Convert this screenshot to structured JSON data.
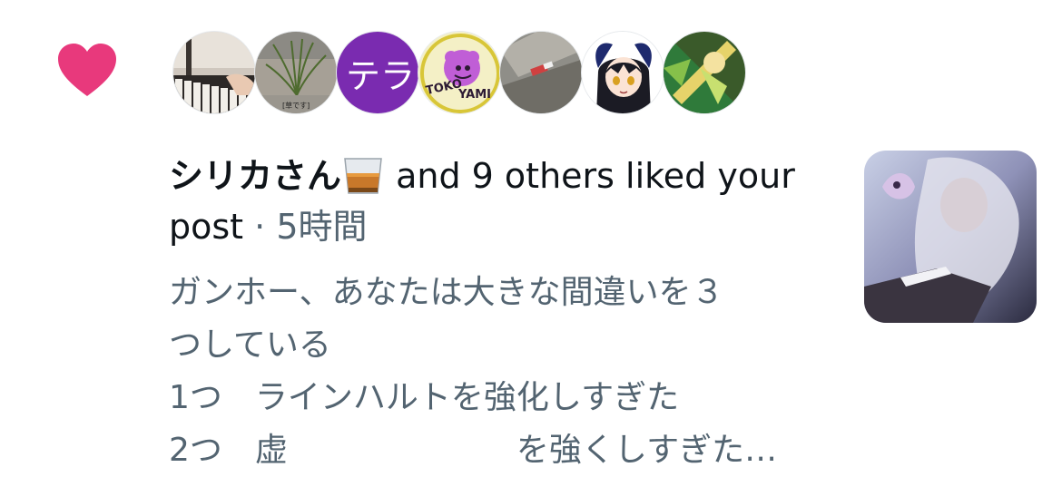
{
  "notification": {
    "type_icon": "heart-icon",
    "accent_color": "#e8397c",
    "avatars": [
      {
        "name": "avatar-piano",
        "kind": "photo"
      },
      {
        "name": "avatar-grass",
        "kind": "photo",
        "caption": "[草です]"
      },
      {
        "name": "avatar-tera",
        "kind": "initials",
        "initials": "テラ"
      },
      {
        "name": "avatar-tokoyami",
        "kind": "logo",
        "logo_text_1": "TOKO",
        "logo_text_2": "YAMI"
      },
      {
        "name": "avatar-street",
        "kind": "photo"
      },
      {
        "name": "avatar-anime-girl",
        "kind": "illustration"
      },
      {
        "name": "avatar-card-art",
        "kind": "illustration"
      }
    ],
    "user_name": "シリカさん",
    "user_emoji": "tumbler-glass-emoji",
    "action_text": " and 9 others liked your post",
    "separator": " · ",
    "time": "5時間",
    "post_lines": [
      "ガンホー、あなたは大きな間違いを３",
      "つしている",
      "1つ　ラインハルトを強化しすぎた",
      "2つ　虚　　　　　　　を強くしすぎた…"
    ],
    "thumbnail": "post-thumbnail-image"
  }
}
